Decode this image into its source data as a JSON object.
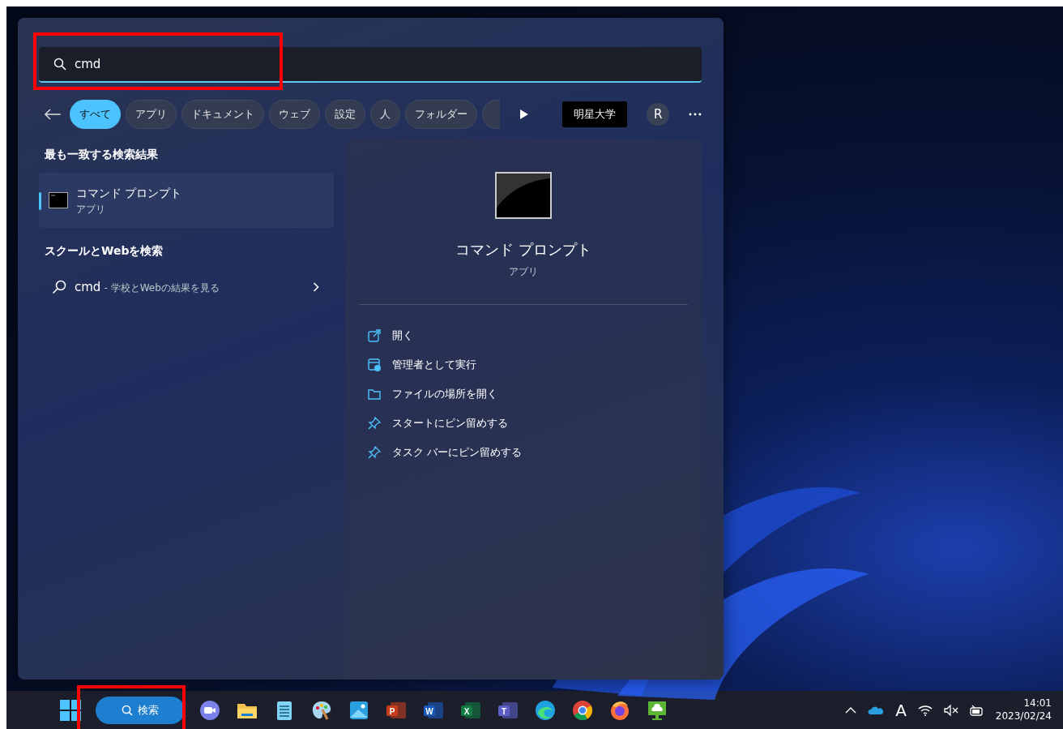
{
  "search": {
    "value": "cmd",
    "highlighted": true
  },
  "filters": [
    {
      "label": "すべて",
      "selected": true
    },
    {
      "label": "アプリ",
      "selected": false
    },
    {
      "label": "ドキュメント",
      "selected": false
    },
    {
      "label": "ウェブ",
      "selected": false
    },
    {
      "label": "設定",
      "selected": false
    },
    {
      "label": "人",
      "selected": false
    },
    {
      "label": "フォルダー",
      "selected": false
    }
  ],
  "filters_cut_off": true,
  "org_badge": "明星大学",
  "avatar": "R",
  "best_match": {
    "heading": "最も一致する検索結果",
    "title": "コマンド プロンプト",
    "subtitle": "アプリ",
    "selected": true
  },
  "web_search": {
    "heading": "スクールとWebを検索",
    "query": "cmd",
    "hint": "- 学校とWebの結果を見る"
  },
  "preview": {
    "title": "コマンド プロンプト",
    "subtitle": "アプリ",
    "actions": [
      {
        "kind": "open",
        "label": "開く"
      },
      {
        "kind": "admin",
        "label": "管理者として実行"
      },
      {
        "kind": "folder",
        "label": "ファイルの場所を開く"
      },
      {
        "kind": "pin",
        "label": "スタートにピン留めする"
      },
      {
        "kind": "pin",
        "label": "タスク バーにピン留めする"
      }
    ]
  },
  "taskbar": {
    "search": {
      "label": "検索",
      "highlighted": true
    },
    "apps": [
      {
        "kind": "chat"
      },
      {
        "kind": "explorer"
      },
      {
        "kind": "notepad"
      },
      {
        "kind": "paint"
      },
      {
        "kind": "photos"
      },
      {
        "kind": "office",
        "letter": "P",
        "color": "#c43e1c"
      },
      {
        "kind": "office",
        "letter": "W",
        "color": "#185abd"
      },
      {
        "kind": "office",
        "letter": "X",
        "color": "#107c41"
      },
      {
        "kind": "office",
        "letter": "T",
        "color": "#5b5fc7"
      },
      {
        "kind": "edge"
      },
      {
        "kind": "chrome"
      },
      {
        "kind": "firefox"
      },
      {
        "kind": "remote"
      }
    ],
    "ime": "A",
    "time": "14:01",
    "date": "2023/02/24"
  }
}
